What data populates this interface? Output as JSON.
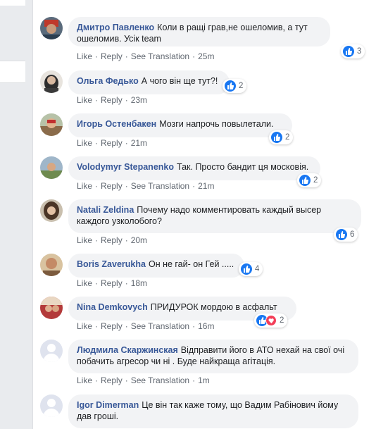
{
  "comments": [
    {
      "author": "Дмитро Павленко",
      "text": "Коли в ращі грав,не ошеломив, а тут ошеломив. Усік team",
      "reaction_count": "3",
      "actions": {
        "like": "Like",
        "reply": "Reply",
        "translate": "See Translation"
      },
      "time": "25m"
    },
    {
      "author": "Ольга Федько",
      "text": "А чого він ще тут?!",
      "reaction_count": "2",
      "actions": {
        "like": "Like",
        "reply": "Reply"
      },
      "time": "23m"
    },
    {
      "author": "Игорь Остенбакен",
      "text": "Мозги напрочь повылетали.",
      "reaction_count": "2",
      "actions": {
        "like": "Like",
        "reply": "Reply"
      },
      "time": "21m"
    },
    {
      "author": "Volodymyr Stepanenko",
      "text": "Так. Просто бандит ця московія.",
      "reaction_count": "2",
      "actions": {
        "like": "Like",
        "reply": "Reply",
        "translate": "See Translation"
      },
      "time": "21m"
    },
    {
      "author": "Natali Zeldina",
      "text": "Почему надо комментировать каждый высер каждого узколобого?",
      "reaction_count": "6",
      "actions": {
        "like": "Like",
        "reply": "Reply"
      },
      "time": "20m"
    },
    {
      "author": "Boris Zaverukha",
      "text": "Он не гай- он Гей .....",
      "reaction_count": "4",
      "actions": {
        "like": "Like",
        "reply": "Reply"
      },
      "time": "18m"
    },
    {
      "author": "Nina Demkovych",
      "text": "ПРИДУРОК мордою в асфальт",
      "reaction_count": "2",
      "actions": {
        "like": "Like",
        "reply": "Reply",
        "translate": "See Translation"
      },
      "time": "16m"
    },
    {
      "author": "Людмила Скаржинская",
      "text": "Відправити його в АТО нехай на свої очі побачить агресор чи ні . Буде найкраща агітація.",
      "actions": {
        "like": "Like",
        "reply": "Reply",
        "translate": "See Translation"
      },
      "time": "1m"
    },
    {
      "author": "Igor Dimerman",
      "text": "Це він так каже тому, що Вадим Рабінович йому дав гроші."
    }
  ],
  "colors": {
    "link": "#385898",
    "bubble": "#f2f3f5",
    "like": "#1877f2",
    "love": "#f33e58"
  }
}
